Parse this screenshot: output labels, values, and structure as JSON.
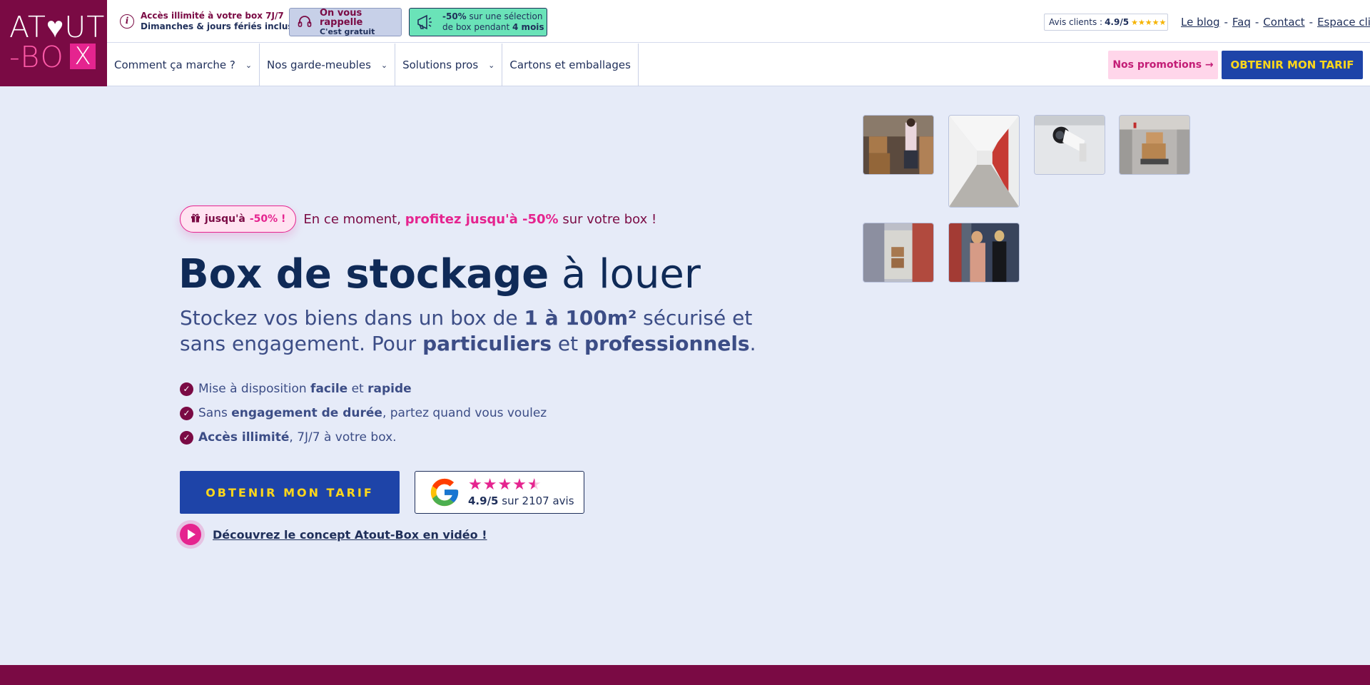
{
  "logo": {
    "line1_left": "AT",
    "line1_right": "UT",
    "line2": "-BO",
    "x_mark": "X"
  },
  "topbar": {
    "access_line1": "Accès illimité à votre box 7J/7",
    "access_line2": "Dimanches & jours fériés inclus",
    "callback_line1": "On vous rappelle",
    "callback_line2": "C'est gratuit",
    "promo_bold": "-50%",
    "promo_rest1": " sur une sélection",
    "promo_line2_pre": "de box pendant ",
    "promo_line2_bold": "4 mois",
    "reviews_label": "Avis clients :",
    "reviews_score": "4.9/5",
    "reviews_stars": "★★★★★",
    "links": [
      "Le blog",
      "Faq",
      "Contact",
      "Espace client"
    ],
    "separator": "-"
  },
  "nav": {
    "items": [
      {
        "label": "Comment ça marche ?",
        "has_dropdown": true
      },
      {
        "label": "Nos garde-meubles",
        "has_dropdown": true
      },
      {
        "label": "Solutions pros",
        "has_dropdown": true
      },
      {
        "label": "Cartons et emballages",
        "has_dropdown": false
      }
    ],
    "promos_label": "Nos promotions →",
    "tarif_label": "OBTENIR MON TARIF"
  },
  "hero": {
    "badge_pre": "jusqu'à ",
    "badge_pink": "-50% !",
    "msg_pre": "En ce moment, ",
    "msg_bold": "profitez jusqu'à -50%",
    "msg_post": " sur votre box !",
    "title_bold": "Box de stockage",
    "title_light": " à louer",
    "sub_1": "Stockez vos biens dans un box de ",
    "sub_b1": "1 à 100m²",
    "sub_2": " sécurisé et sans engagement. Pour ",
    "sub_b2": "particuliers",
    "sub_3": " et ",
    "sub_b3": "professionnels",
    "sub_4": ".",
    "bullets": [
      {
        "pre": "Mise à disposition ",
        "b1": "facile",
        "mid": " et ",
        "b2": "rapide",
        "post": ""
      },
      {
        "pre": "Sans ",
        "b1": "engagement de durée",
        "mid": ", partez quand vous voulez",
        "b2": "",
        "post": ""
      },
      {
        "pre": "",
        "b1": "Accès illimité",
        "mid": ", 7J/7 à votre box.",
        "b2": "",
        "post": ""
      }
    ],
    "cta_label": "OBTENIR MON TARIF",
    "google_score": "4.9/5",
    "google_text": " sur 2107 avis",
    "google_stars": "★★★★",
    "google_half": "★",
    "video_label": "Découvrez le concept Atout-Box en vidéo !"
  },
  "colors": {
    "brand_plum": "#7a0a44",
    "brand_pink": "#e5248f",
    "brand_blue": "#1e44a8",
    "brand_yellow": "#ffd71a",
    "hero_bg": "#e6ebf8",
    "promo_green": "#6ae3b8"
  },
  "icons": {
    "info": "info-icon",
    "callback": "headset-icon",
    "promo": "megaphone-icon",
    "badge": "gift-icon",
    "check": "check-icon",
    "play": "play-icon",
    "google": "google-logo-icon"
  }
}
